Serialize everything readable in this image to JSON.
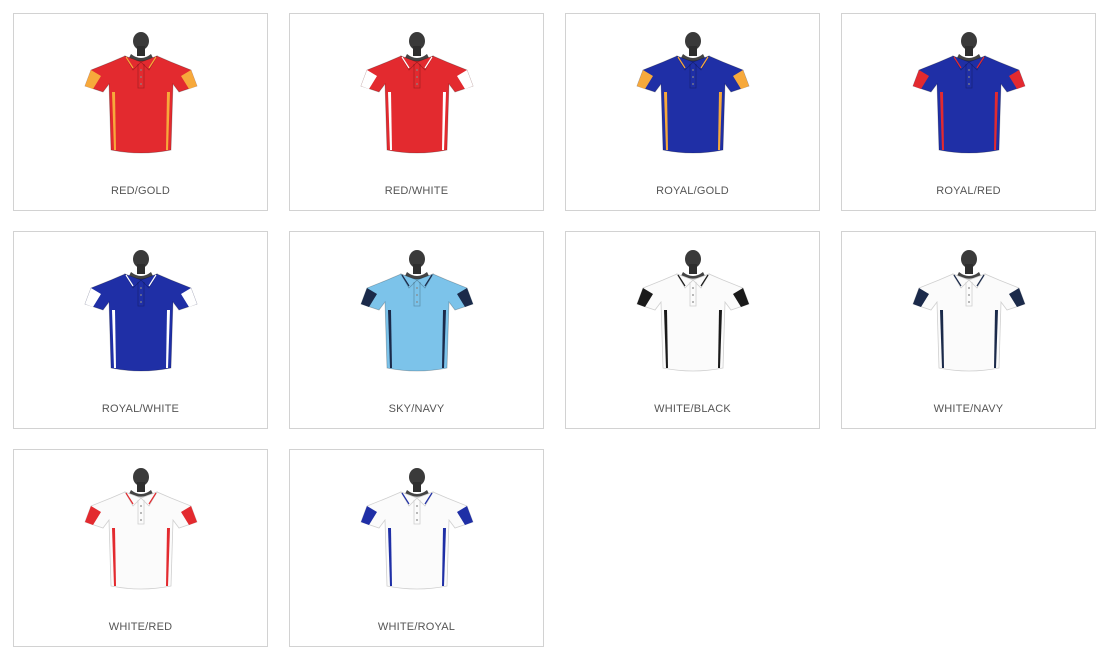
{
  "swatches": [
    {
      "label": "RED/GOLD",
      "icon": "polo-shirt-icon",
      "body_color": "#e32a2f",
      "trim_color": "#f7a93b",
      "collar_color": "#e32a2f"
    },
    {
      "label": "RED/WHITE",
      "icon": "polo-shirt-icon",
      "body_color": "#e32a2f",
      "trim_color": "#ffffff",
      "collar_color": "#e32a2f"
    },
    {
      "label": "ROYAL/GOLD",
      "icon": "polo-shirt-icon",
      "body_color": "#1f2fa6",
      "trim_color": "#f7a93b",
      "collar_color": "#1f2fa6"
    },
    {
      "label": "ROYAL/RED",
      "icon": "polo-shirt-icon",
      "body_color": "#1f2fa6",
      "trim_color": "#e32a2f",
      "collar_color": "#1f2fa6"
    },
    {
      "label": "ROYAL/WHITE",
      "icon": "polo-shirt-icon",
      "body_color": "#1f2fa6",
      "trim_color": "#ffffff",
      "collar_color": "#1f2fa6"
    },
    {
      "label": "SKY/NAVY",
      "icon": "polo-shirt-icon",
      "body_color": "#7cc3ea",
      "trim_color": "#1b2a4a",
      "collar_color": "#7cc3ea"
    },
    {
      "label": "WHITE/BLACK",
      "icon": "polo-shirt-icon",
      "body_color": "#fbfbfb",
      "trim_color": "#1a1a1a",
      "collar_color": "#fbfbfb"
    },
    {
      "label": "WHITE/NAVY",
      "icon": "polo-shirt-icon",
      "body_color": "#fbfbfb",
      "trim_color": "#1b2a4a",
      "collar_color": "#fbfbfb"
    },
    {
      "label": "WHITE/RED",
      "icon": "polo-shirt-icon",
      "body_color": "#fbfbfb",
      "trim_color": "#e32a2f",
      "collar_color": "#fbfbfb"
    },
    {
      "label": "WHITE/ROYAL",
      "icon": "polo-shirt-icon",
      "body_color": "#fbfbfb",
      "trim_color": "#1f2fa6",
      "collar_color": "#fbfbfb"
    }
  ]
}
